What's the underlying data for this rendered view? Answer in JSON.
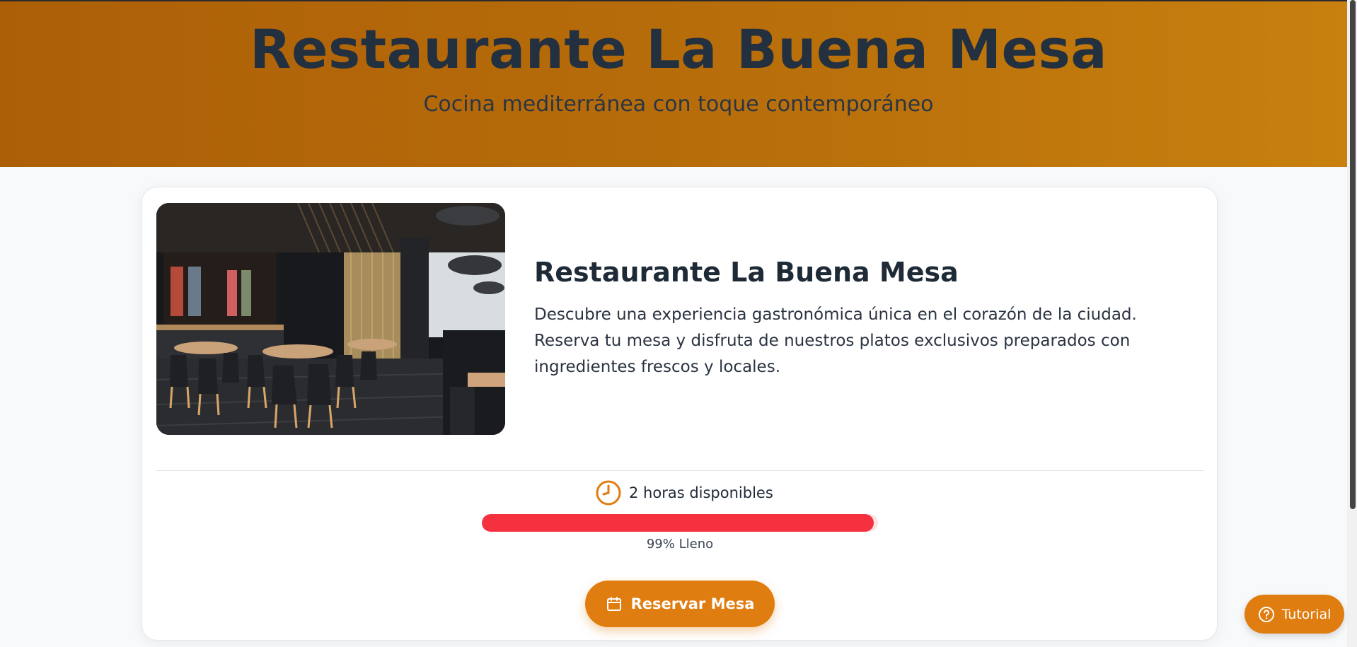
{
  "header": {
    "title": "Restaurante La Buena Mesa",
    "subtitle": "Cocina mediterránea con toque contemporáneo"
  },
  "restaurant": {
    "name": "Restaurante La Buena Mesa",
    "description": "Descubre una experiencia gastronómica única en el corazón de la ciudad. Reserva tu mesa y disfruta de nuestros platos exclusivos preparados con ingredientes frescos y locales.",
    "image_icon": "restaurant-interior-photo"
  },
  "availability": {
    "icon": "clock-icon",
    "text": "2 horas disponibles",
    "fill_percent": 99,
    "fill_label": "99% Lleno"
  },
  "actions": {
    "reserve_label": "Reservar Mesa",
    "reserve_icon": "calendar-icon",
    "tutorial_label": "Tutorial",
    "tutorial_icon": "help-icon"
  },
  "colors": {
    "accent": "#e07d10",
    "progress": "#f5303f",
    "header_from": "#ad5f08",
    "header_to": "#c8800f"
  }
}
